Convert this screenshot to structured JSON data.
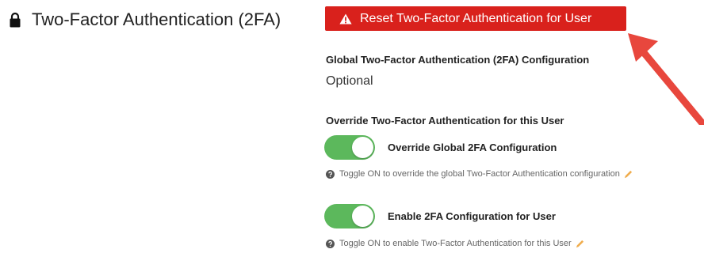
{
  "section": {
    "title": "Two-Factor Authentication (2FA)",
    "icon": "lock-icon"
  },
  "reset_button": {
    "label": "Reset Two-Factor Authentication for User",
    "icon": "warning-icon",
    "color": "#d9211c"
  },
  "global_config": {
    "label": "Global Two-Factor Authentication (2FA) Configuration",
    "value": "Optional"
  },
  "override_section": {
    "label": "Override Two-Factor Authentication for this User"
  },
  "toggles": [
    {
      "label": "Override Global 2FA Configuration",
      "state": "on",
      "help": "Toggle ON to override the global Two-Factor Authentication configuration",
      "color": "#5cb85c"
    },
    {
      "label": "Enable 2FA Configuration for User",
      "state": "on",
      "help": "Toggle ON to enable Two-Factor Authentication for this User",
      "color": "#5cb85c"
    }
  ],
  "annotation": {
    "type": "arrow",
    "color": "#e8473d"
  }
}
